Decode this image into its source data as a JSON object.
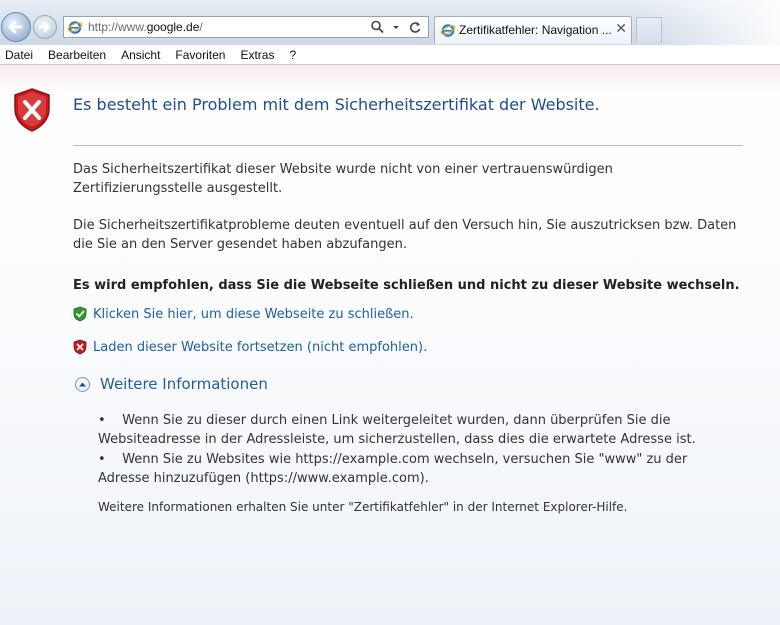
{
  "browser": {
    "address": {
      "url_prefix": "http://www.",
      "url_host": "google.de",
      "url_suffix": "/"
    },
    "tab": {
      "title": "Zertifikatfehler: Navigation ...",
      "close_glyph": "✕"
    },
    "menu": [
      "Datei",
      "Bearbeiten",
      "Ansicht",
      "Favoriten",
      "Extras",
      "?"
    ],
    "icons": {
      "back": "back-arrow-icon",
      "forward": "forward-arrow-icon",
      "search": "search-icon",
      "refresh": "refresh-icon"
    }
  },
  "page": {
    "title": "Es besteht ein Problem mit dem Sicherheitszertifikat der Website.",
    "paragraph1": "Das Sicherheitszertifikat dieser Website wurde nicht von einer vertrauenswürdigen Zertifizierungsstelle ausgestellt.",
    "paragraph2": "Die Sicherheitszertifikatprobleme deuten eventuell auf den Versuch hin, Sie auszutricksen bzw. Daten die Sie an den Server gesendet haben abzufangen.",
    "recommendation": "Es wird empfohlen, dass Sie die Webseite schließen und nicht zu dieser Website wechseln.",
    "link_close": "Klicken Sie hier, um diese Webseite zu schließen.",
    "link_continue": "Laden dieser Website fortsetzen (nicht empfohlen).",
    "more_info_label": "Weitere Informationen",
    "info_items": [
      "Wenn Sie zu dieser durch einen Link weitergeleitet wurden, dann überprüfen Sie die Websiteadresse in der Adressleiste, um sicherzustellen, dass dies die erwartete Adresse ist.",
      "Wenn Sie zu Websites wie https://example.com wechseln, versuchen Sie \"www\" zu der Adresse hinzuzufügen (https://www.example.com)."
    ],
    "footer_note": "Weitere Informationen erhalten Sie unter \"Zertifikatfehler\" in der Internet Explorer-Hilfe.",
    "bullet": "•"
  },
  "colors": {
    "title_blue": "#1f4d8f",
    "link_blue": "#1d5fa6",
    "shield_red": "#c8171e",
    "shield_green": "#2e9b2e"
  }
}
